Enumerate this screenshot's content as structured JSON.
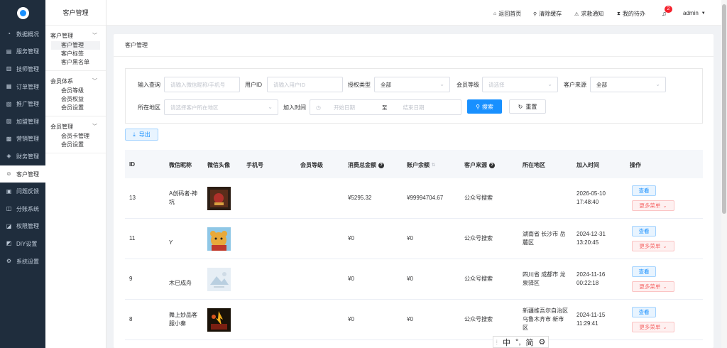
{
  "sidebar": {
    "items": [
      {
        "label": "数据概况",
        "icon": "dashboard-icon",
        "glyph": "◔"
      },
      {
        "label": "服务管理",
        "icon": "service-icon",
        "glyph": "▤"
      },
      {
        "label": "技师管理",
        "icon": "technician-icon",
        "glyph": "▥"
      },
      {
        "label": "订单管理",
        "icon": "order-icon",
        "glyph": "▦"
      },
      {
        "label": "推广管理",
        "icon": "promotion-icon",
        "glyph": "▧"
      },
      {
        "label": "加盟管理",
        "icon": "franchise-icon",
        "glyph": "▨"
      },
      {
        "label": "营销管理",
        "icon": "marketing-icon",
        "glyph": "▩"
      },
      {
        "label": "财务管理",
        "icon": "finance-icon",
        "glyph": "◈"
      },
      {
        "label": "客户管理",
        "icon": "customer-icon",
        "glyph": "☺",
        "active": true
      },
      {
        "label": "问题反馈",
        "icon": "feedback-icon",
        "glyph": "▣"
      },
      {
        "label": "分账系统",
        "icon": "split-icon",
        "glyph": "◫"
      },
      {
        "label": "权限管理",
        "icon": "permission-icon",
        "glyph": "◪"
      },
      {
        "label": "DIY设置",
        "icon": "diy-icon",
        "glyph": "◩"
      },
      {
        "label": "系统设置",
        "icon": "settings-icon",
        "glyph": "⚙"
      }
    ]
  },
  "submenu": {
    "title": "客户管理",
    "groups": [
      {
        "title": "客户管理",
        "items": [
          "客户管理",
          "客户标签",
          "客户黑名单"
        ]
      },
      {
        "title": "会员体系",
        "items": [
          "会员等级",
          "会员权益",
          "会员设置"
        ]
      },
      {
        "title": "会员管理",
        "items": [
          "会员卡管理",
          "会员设置"
        ]
      }
    ]
  },
  "topbar": {
    "home": "返回首页",
    "clear_cache": "清除缓存",
    "help": "求救通知",
    "todo": "我的待办",
    "badge": "2",
    "user": "admin"
  },
  "breadcrumb": "客户管理",
  "filter": {
    "query_label": "输入查询",
    "query_placeholder": "请输入微信昵称/手机号",
    "uid_label": "用户ID",
    "uid_placeholder": "请输入用户ID",
    "auth_label": "授权类型",
    "auth_value": "全部",
    "level_label": "会员等级",
    "level_placeholder": "请选择",
    "source_label": "客户来源",
    "source_value": "全部",
    "region_label": "所在地区",
    "region_placeholder": "请选择客户所在地区",
    "time_label": "加入时间",
    "start_placeholder": "开始日期",
    "to": "至",
    "end_placeholder": "结束日期",
    "search": "搜索",
    "reset": "重置"
  },
  "export": "导出",
  "table": {
    "headers": [
      "ID",
      "微信昵称",
      "微信头像",
      "手机号",
      "会员等级",
      "消费总金额",
      "账户余额",
      "客户来源",
      "所在地区",
      "加入时间",
      "操作"
    ],
    "rows": [
      {
        "id": "13",
        "nick": [
          "A创码者-神",
          "坑"
        ],
        "phone": "",
        "level": "",
        "total": "¥5295.32",
        "balance": "¥99994704.67",
        "source": "公众号搜索",
        "region": [],
        "time": [
          "2026-05-10",
          "17:48:40"
        ],
        "avatar": "avatar-dark"
      },
      {
        "id": "11",
        "nick": [
          "Y"
        ],
        "phone": "",
        "level": "",
        "total": "¥0",
        "balance": "¥0",
        "source": "公众号搜索",
        "region": [
          "湖南省 长沙市 岳",
          "麓区"
        ],
        "time": [
          "2024-12-31",
          "13:20:45"
        ],
        "avatar": "avatar-bear"
      },
      {
        "id": "9",
        "nick": [
          "木已成舟"
        ],
        "phone": "",
        "level": "",
        "total": "¥0",
        "balance": "¥0",
        "source": "公众号搜索",
        "region": [
          "四川省 成都市 龙",
          "泉驿区"
        ],
        "time": [
          "2024-11-16",
          "00:22:18"
        ],
        "avatar": "avatar-landscape"
      },
      {
        "id": "8",
        "nick": [
          "舞上妙品客",
          "服小秦"
        ],
        "phone": "",
        "level": "",
        "total": "¥0",
        "balance": "¥0",
        "source": "公众号搜索",
        "region": [
          "新疆维吾尔自治区",
          "乌鲁木齐市 新市",
          "区"
        ],
        "time": [
          "2024-11-15",
          "11:29:41"
        ],
        "avatar": "avatar-fire"
      }
    ],
    "view": "查看",
    "more": "更多菜单"
  },
  "ime": {
    "zh": "中",
    "punct": "°,",
    "simp": "简"
  }
}
